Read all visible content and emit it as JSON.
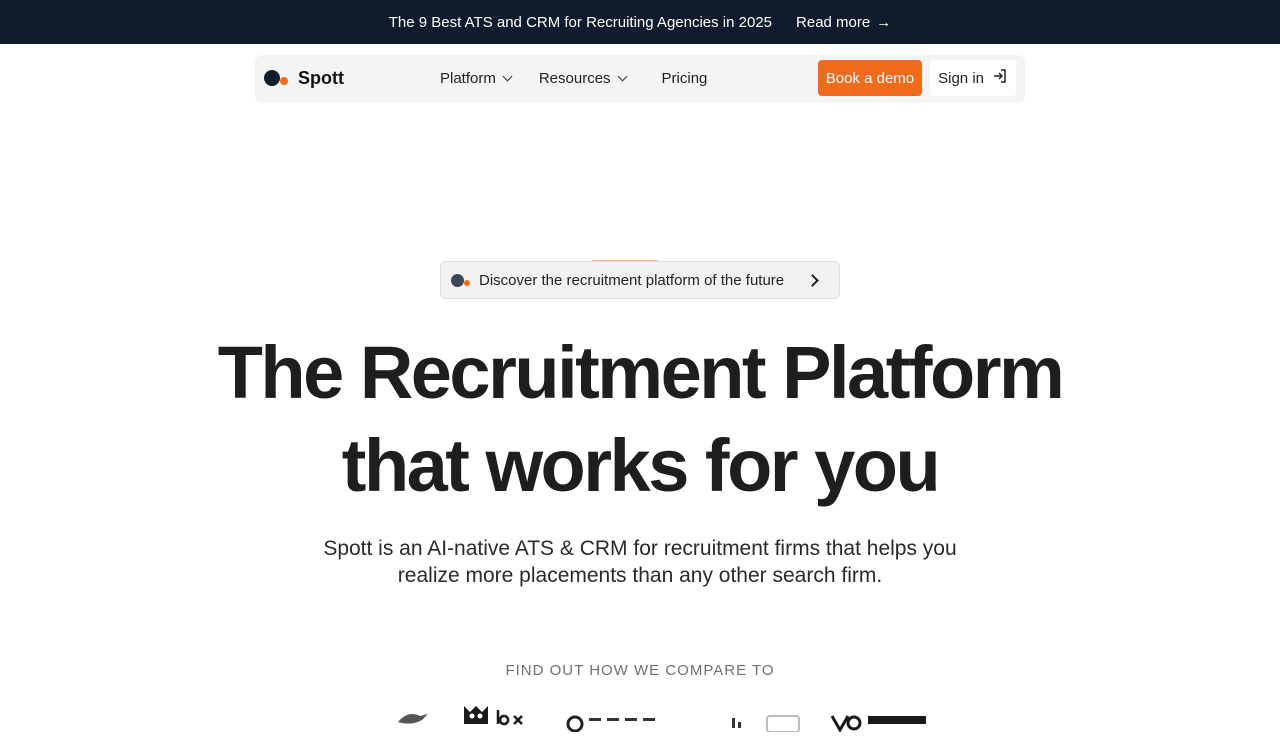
{
  "banner": {
    "text": "The 9 Best ATS and CRM for Recruiting Agencies in 2025",
    "link_label": "Read more",
    "link_arrow": "→"
  },
  "nav": {
    "logo_text": "Spott",
    "menu": [
      {
        "label": "Platform",
        "has_dropdown": true
      },
      {
        "label": "Resources",
        "has_dropdown": true
      },
      {
        "label": "Pricing",
        "has_dropdown": false
      }
    ],
    "demo_button": "Book a demo",
    "signin_button": "Sign in"
  },
  "hero": {
    "pill_text": "Discover the recruitment platform of the future",
    "title_line1": "The Recruitment Platform",
    "title_line2": "that works for you",
    "subtitle_line1": "Spott is an AI-native ATS & CRM for recruitment firms that helps you",
    "subtitle_line2": "realize more placements than any other search firm."
  },
  "compare": {
    "heading": "FIND OUT HOW WE COMPARE TO",
    "logos": [
      "bird-logo-icon",
      "loxo-logo",
      "ezekia-logo",
      "recruit-crm-logo",
      "screen-logo-icon",
      "vincere-logo"
    ]
  },
  "colors": {
    "banner_bg": "#0f1c2e",
    "accent": "#f26a1b",
    "nav_bg": "#f4f4f4"
  }
}
